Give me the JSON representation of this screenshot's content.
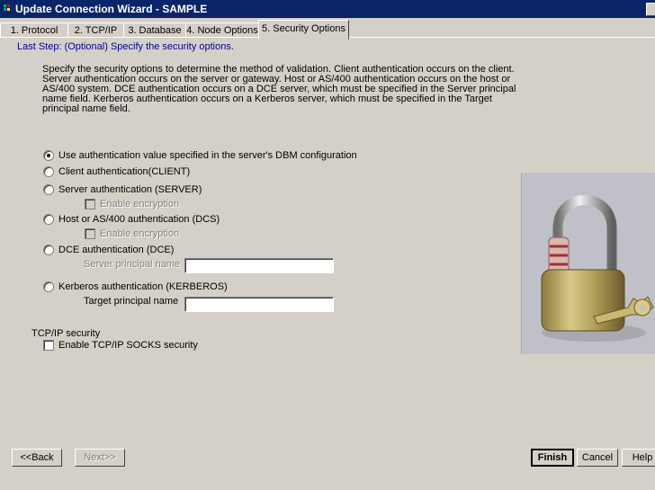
{
  "window": {
    "title": "Update Connection Wizard - SAMPLE"
  },
  "tabs": [
    {
      "label": "1. Protocol"
    },
    {
      "label": "2. TCP/IP"
    },
    {
      "label": "3. Database"
    },
    {
      "label": "4. Node Options"
    },
    {
      "label": "5. Security Options"
    }
  ],
  "active_tab": "5. Security Options",
  "page": {
    "subtitle": "Last Step: (Optional) Specify the security options.",
    "description": "Specify the security options to determine the method of validation.  Client authentication occurs on the client.  Server authentication occurs on the server or gateway.  Host or AS/400 authentication occurs on the host or AS/400 system.  DCE authentication occurs on a DCE server, which must be specified in the Server principal name field.  Kerberos authentication occurs on a Kerberos server, which must be specified in the Target principal name field."
  },
  "auth_options": {
    "selected": "Use authentication value specified in the server's DBM configuration",
    "dbm": "Use authentication value specified in the server's DBM configuration",
    "client": "Client authentication(CLIENT)",
    "server": "Server authentication (SERVER)",
    "server_encrypt": "Enable encryption",
    "host": "Host or AS/400 authentication (DCS)",
    "host_encrypt": "Enable encryption",
    "dce": "DCE authentication (DCE)",
    "dce_field_label": "Server principal name",
    "dce_field_value": "",
    "kerberos": "Kerberos authentication (KERBEROS)",
    "kerberos_field_label": "Target principal name",
    "kerberos_field_value": ""
  },
  "tcpip": {
    "section_label": "TCP/IP security",
    "socks_label": "Enable TCP/IP SOCKS security",
    "socks_checked": false
  },
  "image": {
    "name": "padlock-with-key-icon"
  },
  "buttons": {
    "back": "<<Back",
    "next": "Next>>",
    "finish": "Finish",
    "cancel": "Cancel",
    "help": "Help"
  },
  "colors": {
    "titlebar": "#0a246a",
    "dialog": "#d4d0c8",
    "subtitle": "#0000a0"
  }
}
